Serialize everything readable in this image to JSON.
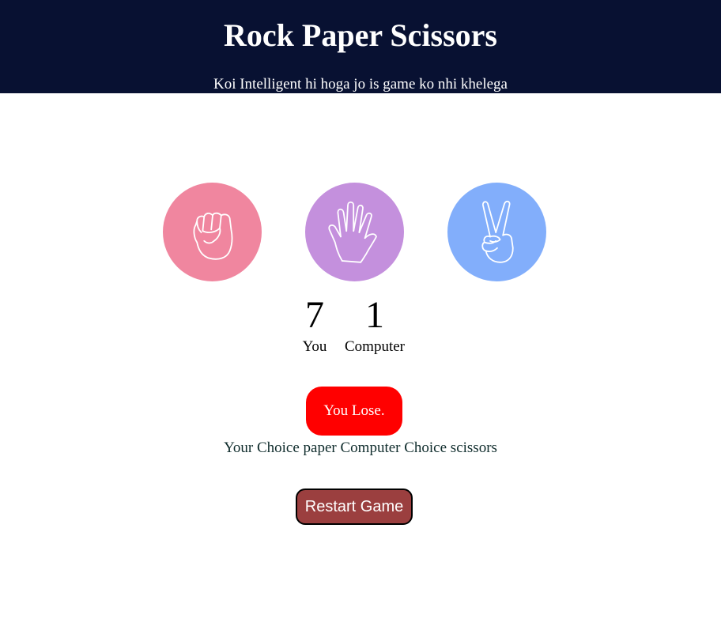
{
  "header": {
    "title": "Rock Paper Scissors",
    "subtitle": "Koi Intelligent hi hoga jo is game ko nhi khelega"
  },
  "choices": [
    {
      "id": "rock",
      "icon": "fist-icon",
      "color": "#f0869f"
    },
    {
      "id": "paper",
      "icon": "open-hand-icon",
      "color": "#c490dd"
    },
    {
      "id": "scissors",
      "icon": "victory-hand-icon",
      "color": "#82aefb"
    }
  ],
  "score": {
    "user_score": "7",
    "user_label": "You",
    "comp_score": "1",
    "comp_label": "Computer"
  },
  "result": {
    "message": "You Lose.",
    "color": "#ff0000",
    "choice_text": "Your Choice paper Computer Choice scissors"
  },
  "controls": {
    "restart_label": "Restart Game",
    "restart_color": "#9b3f3f"
  },
  "colors": {
    "header_bg": "#081132"
  }
}
